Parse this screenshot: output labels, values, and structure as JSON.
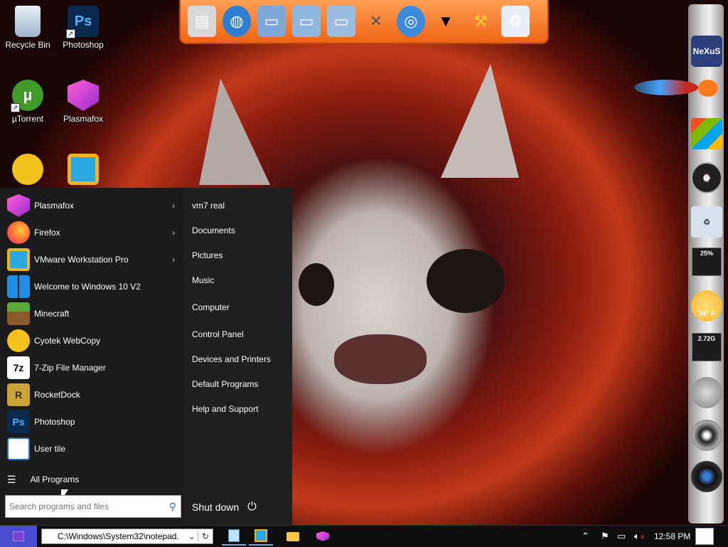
{
  "desktop": {
    "icons": [
      {
        "label": "Recycle Bin"
      },
      {
        "label": "Photoshop",
        "glyph": "Ps"
      },
      {
        "label": "µTorrent",
        "glyph": "µ"
      },
      {
        "label": "Plasmafox"
      },
      {
        "label": ""
      },
      {
        "label": ""
      }
    ]
  },
  "dock": {
    "items": [
      "presentation-icon",
      "globe-document-icon",
      "folder-icon",
      "folder-pictures-icon",
      "folder-network-icon",
      "tools-icon",
      "internet-globe-icon",
      "tshirt-icon",
      "hammer-icon",
      "recycle-bin-icon"
    ]
  },
  "sidebar": {
    "brand": "NeXuS",
    "meter1_value": "25%",
    "weather_temp": "34° F",
    "meter2_value": "2.72G"
  },
  "start_menu": {
    "apps": [
      {
        "label": "Plasmafox",
        "icon": "plasmafox-icon",
        "has_submenu": true
      },
      {
        "label": "Firefox",
        "icon": "firefox-icon",
        "has_submenu": true
      },
      {
        "label": "VMware Workstation Pro",
        "icon": "vmware-icon",
        "has_submenu": true
      },
      {
        "label": "Welcome to Windows 10 V2",
        "icon": "windows-logo-icon",
        "has_submenu": false
      },
      {
        "label": "Minecraft",
        "icon": "minecraft-icon",
        "has_submenu": false
      },
      {
        "label": "Cyotek WebCopy",
        "icon": "webcopy-icon",
        "has_submenu": false
      },
      {
        "label": "7-Zip File Manager",
        "icon": "7zip-icon",
        "glyph": "7z",
        "has_submenu": false
      },
      {
        "label": "RocketDock",
        "icon": "rocketdock-icon",
        "glyph": "R",
        "has_submenu": false
      },
      {
        "label": "Photoshop",
        "icon": "photoshop-icon",
        "glyph": "Ps",
        "has_submenu": false
      },
      {
        "label": "User tile",
        "icon": "user-tile-icon",
        "has_submenu": false
      }
    ],
    "submenu_arrow": "›",
    "all_programs": "All Programs",
    "search": {
      "value": "",
      "placeholder": "Search programs and files"
    },
    "places": [
      "vm7 real",
      "Documents",
      "Pictures",
      "Music",
      "Computer",
      "Control Panel",
      "Devices and Printers",
      "Default Programs",
      "Help and Support"
    ],
    "shutdown_label": "Shut down"
  },
  "taskbar": {
    "address_value": "C:\\Windows\\System32\\notepad.",
    "clock": "12:58 PM"
  }
}
